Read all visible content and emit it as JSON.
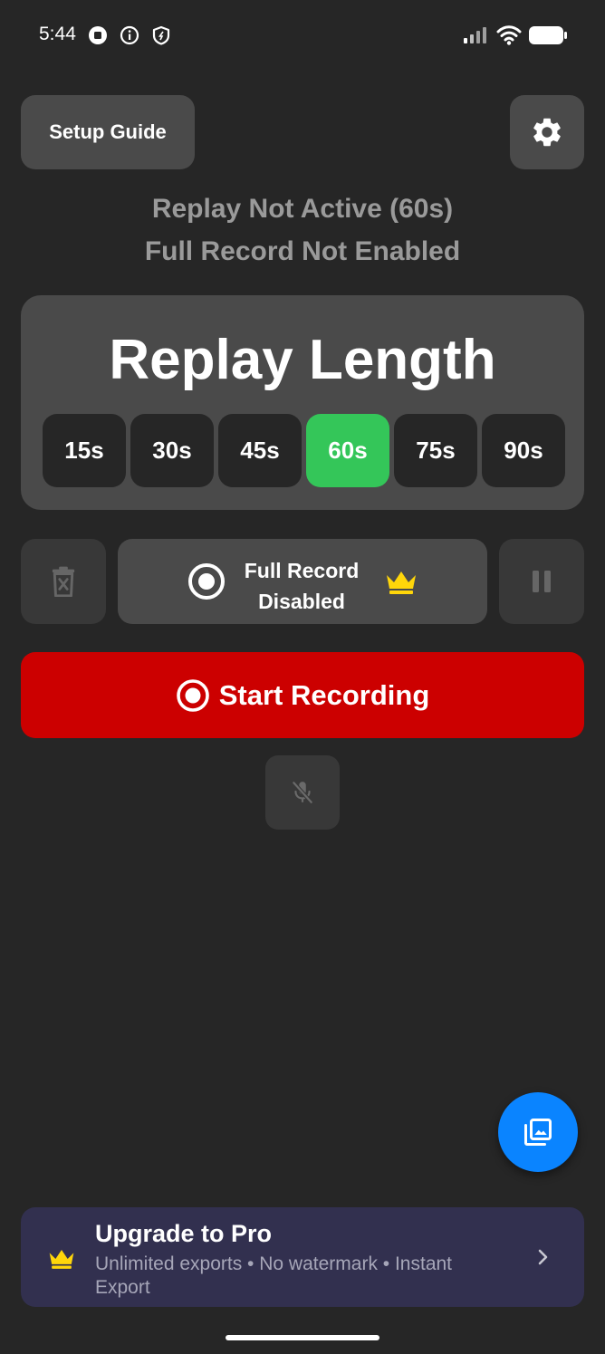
{
  "status_bar": {
    "time": "5:44",
    "left_icons": [
      "stop-circle-icon",
      "info-icon",
      "shield-icon"
    ],
    "right_icons": [
      "signal-icon",
      "wifi-icon",
      "battery-icon"
    ]
  },
  "header": {
    "setup_guide_label": "Setup Guide",
    "settings_icon": "gear-icon"
  },
  "status": {
    "replay": "Replay Not Active (60s)",
    "full_record": "Full Record Not Enabled"
  },
  "replay_card": {
    "title": "Replay Length",
    "options": [
      "15s",
      "30s",
      "45s",
      "60s",
      "75s",
      "90s"
    ],
    "selected": "60s"
  },
  "controls": {
    "full_record_line1": "Full Record",
    "full_record_line2": "Disabled",
    "delete_icon": "trash-icon",
    "pause_icon": "pause-icon",
    "crown_icon": "crown-icon"
  },
  "start_recording": {
    "label": "Start Recording"
  },
  "mic": {
    "icon": "mic-off-icon"
  },
  "fab": {
    "icon": "gallery-icon"
  },
  "upgrade": {
    "title": "Upgrade to Pro",
    "subtitle": "Unlimited exports • No watermark • Instant Export"
  },
  "colors": {
    "background": "#262626",
    "card": "#4a4a4a",
    "selected": "#34c659",
    "record_red": "#cc0000",
    "fab_blue": "#0a84ff",
    "crown_gold": "#ffd60a",
    "banner": "#32304f"
  }
}
